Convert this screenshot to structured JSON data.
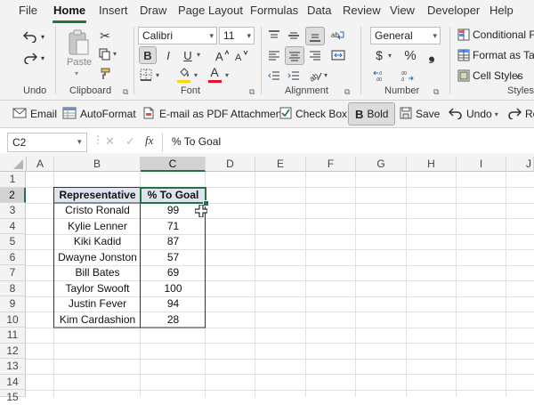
{
  "menu": {
    "tabs": [
      "File",
      "Home",
      "Insert",
      "Draw",
      "Page Layout",
      "Formulas",
      "Data",
      "Review",
      "View",
      "Developer",
      "Help"
    ],
    "active": "Home"
  },
  "ribbon": {
    "undo_group_label": "Undo",
    "clipboard": {
      "paste_label": "Paste",
      "group_label": "Clipboard"
    },
    "font": {
      "name": "Calibri",
      "size": "11",
      "bold": "B",
      "italic": "I",
      "underline": "U",
      "font_color_letter": "A",
      "group_label": "Font"
    },
    "alignment": {
      "group_label": "Alignment"
    },
    "number": {
      "format": "General",
      "currency": "$",
      "percent": "%",
      "comma": "❟",
      "group_label": "Number"
    },
    "styles": {
      "conditional_formatting": "Conditional Fo",
      "format_as_table": "Format as Table",
      "cell_styles": "Cell Styles",
      "group_label": "Styles"
    }
  },
  "qat": {
    "email": "Email",
    "autoformat": "AutoFormat",
    "email_pdf": "E-mail as PDF Attachment",
    "check_box": "Check Box",
    "bold": "Bold",
    "bold_glyph": "B",
    "save": "Save",
    "undo": "Undo",
    "redo": "Re"
  },
  "formula_bar": {
    "name_box": "C2",
    "fx": "fx",
    "content": "% To Goal"
  },
  "columns": [
    "A",
    "B",
    "C",
    "D",
    "E",
    "F",
    "G",
    "H",
    "I",
    "J"
  ],
  "rows": [
    "1",
    "2",
    "3",
    "4",
    "5",
    "6",
    "7",
    "8",
    "9",
    "10",
    "11",
    "12",
    "13",
    "14",
    "15"
  ],
  "table": {
    "headers": [
      "Representative",
      "% To Goal"
    ],
    "data": [
      [
        "Cristo Ronald",
        "99"
      ],
      [
        "Kylie Lenner",
        "71"
      ],
      [
        "Kiki Kadid",
        "87"
      ],
      [
        "Dwayne Jonston",
        "57"
      ],
      [
        "Bill Bates",
        "69"
      ],
      [
        "Taylor Swooft",
        "100"
      ],
      [
        "Justin Fever",
        "94"
      ],
      [
        "Kim Cardashion",
        "28"
      ]
    ]
  },
  "colors": {
    "accent": "#217346",
    "header_fill": "#dde4ee",
    "font_color_bar": "#e81123",
    "fill_color_bar": "#ffd400"
  }
}
